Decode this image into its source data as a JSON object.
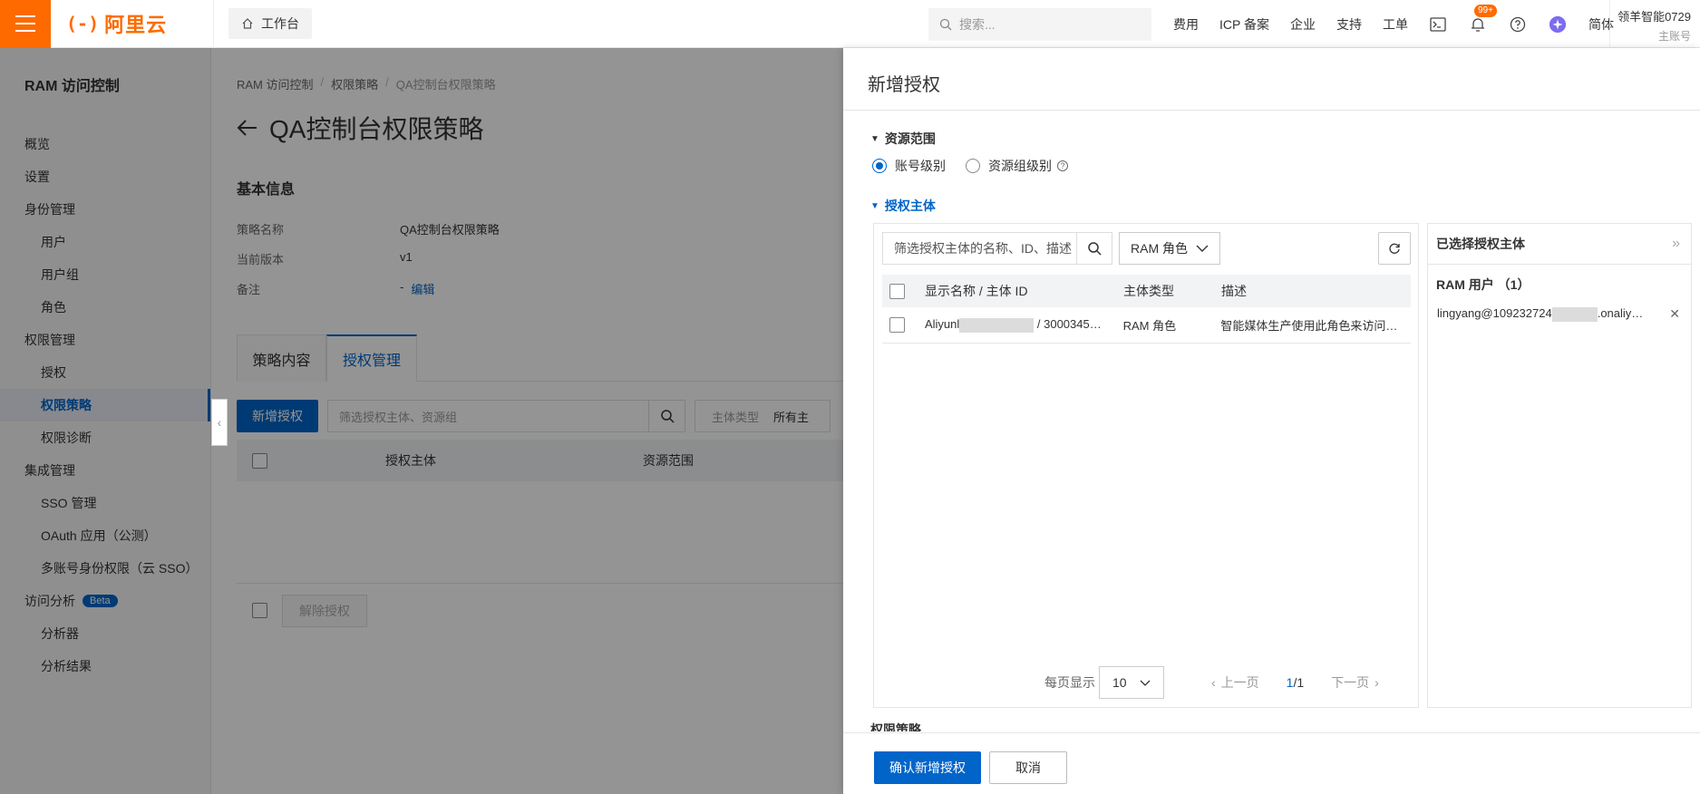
{
  "topbar": {
    "logo_text": "阿里云",
    "workbench": "工作台",
    "search_placeholder": "搜索...",
    "nav": [
      "费用",
      "ICP 备案",
      "企业",
      "支持",
      "工单"
    ],
    "notify_badge": "99+",
    "lang": "简体",
    "user_name": "领羊智能0729",
    "user_role": "主账号",
    "accent": "#ff6a00"
  },
  "sidebar": {
    "title": "RAM 访问控制",
    "items": [
      {
        "label": "概览"
      },
      {
        "label": "设置"
      },
      {
        "label": "身份管理"
      },
      {
        "label": "用户"
      },
      {
        "label": "用户组"
      },
      {
        "label": "角色"
      },
      {
        "label": "权限管理"
      },
      {
        "label": "授权"
      },
      {
        "label": "权限策略"
      },
      {
        "label": "权限诊断"
      },
      {
        "label": "集成管理"
      },
      {
        "label": "SSO 管理"
      },
      {
        "label": "OAuth 应用（公测）"
      },
      {
        "label": "多账号身份权限（云 SSO）"
      },
      {
        "label": "访问分析"
      },
      {
        "label": "分析器"
      },
      {
        "label": "分析结果"
      }
    ],
    "beta_badge": "Beta"
  },
  "main": {
    "breadcrumb": [
      "RAM 访问控制",
      "权限策略",
      "QA控制台权限策略"
    ],
    "title": "QA控制台权限策略",
    "basic_info_title": "基本信息",
    "info": {
      "name_label": "策略名称",
      "name_value": "QA控制台权限策略",
      "version_label": "当前版本",
      "version_value": "v1",
      "note_label": "备注",
      "note_value": "-",
      "note_edit": "编辑"
    },
    "tabs": [
      "策略内容",
      "授权管理"
    ],
    "add_button": "新增授权",
    "filter_placeholder": "筛选授权主体、资源组",
    "type_label": "主体类型",
    "type_value": "所有主",
    "columns": [
      "授权主体",
      "资源范围"
    ],
    "revoke_button": "解除授权"
  },
  "drawer": {
    "title": "新增授权",
    "scope_section": "资源范围",
    "scope_options": [
      "账号级别",
      "资源组级别"
    ],
    "principal_section": "授权主体",
    "search_placeholder": "筛选授权主体的名称、ID、描述",
    "type_select": "RAM 角色",
    "columns": [
      "显示名称 / 主体 ID",
      "主体类型",
      "描述"
    ],
    "rows": [
      {
        "name_prefix": "Aliyunl",
        "name_suffix": "/ 3000345…",
        "type": "RAM 角色",
        "desc": "智能媒体生产使用此角色来访问…"
      }
    ],
    "pager": {
      "label": "每页显示",
      "size": "10",
      "prev": "上一页",
      "current": "1",
      "total": "/1",
      "next": "下一页"
    },
    "selected_title": "已选择授权主体",
    "selected_group": "RAM 用户 （1）",
    "selected_item_prefix": "lingyang@109232724",
    "selected_item_suffix": ".onaliy…",
    "cut_section": "权限策略",
    "confirm": "确认新增授权",
    "cancel": "取消",
    "primary_color": "#0064c8"
  }
}
